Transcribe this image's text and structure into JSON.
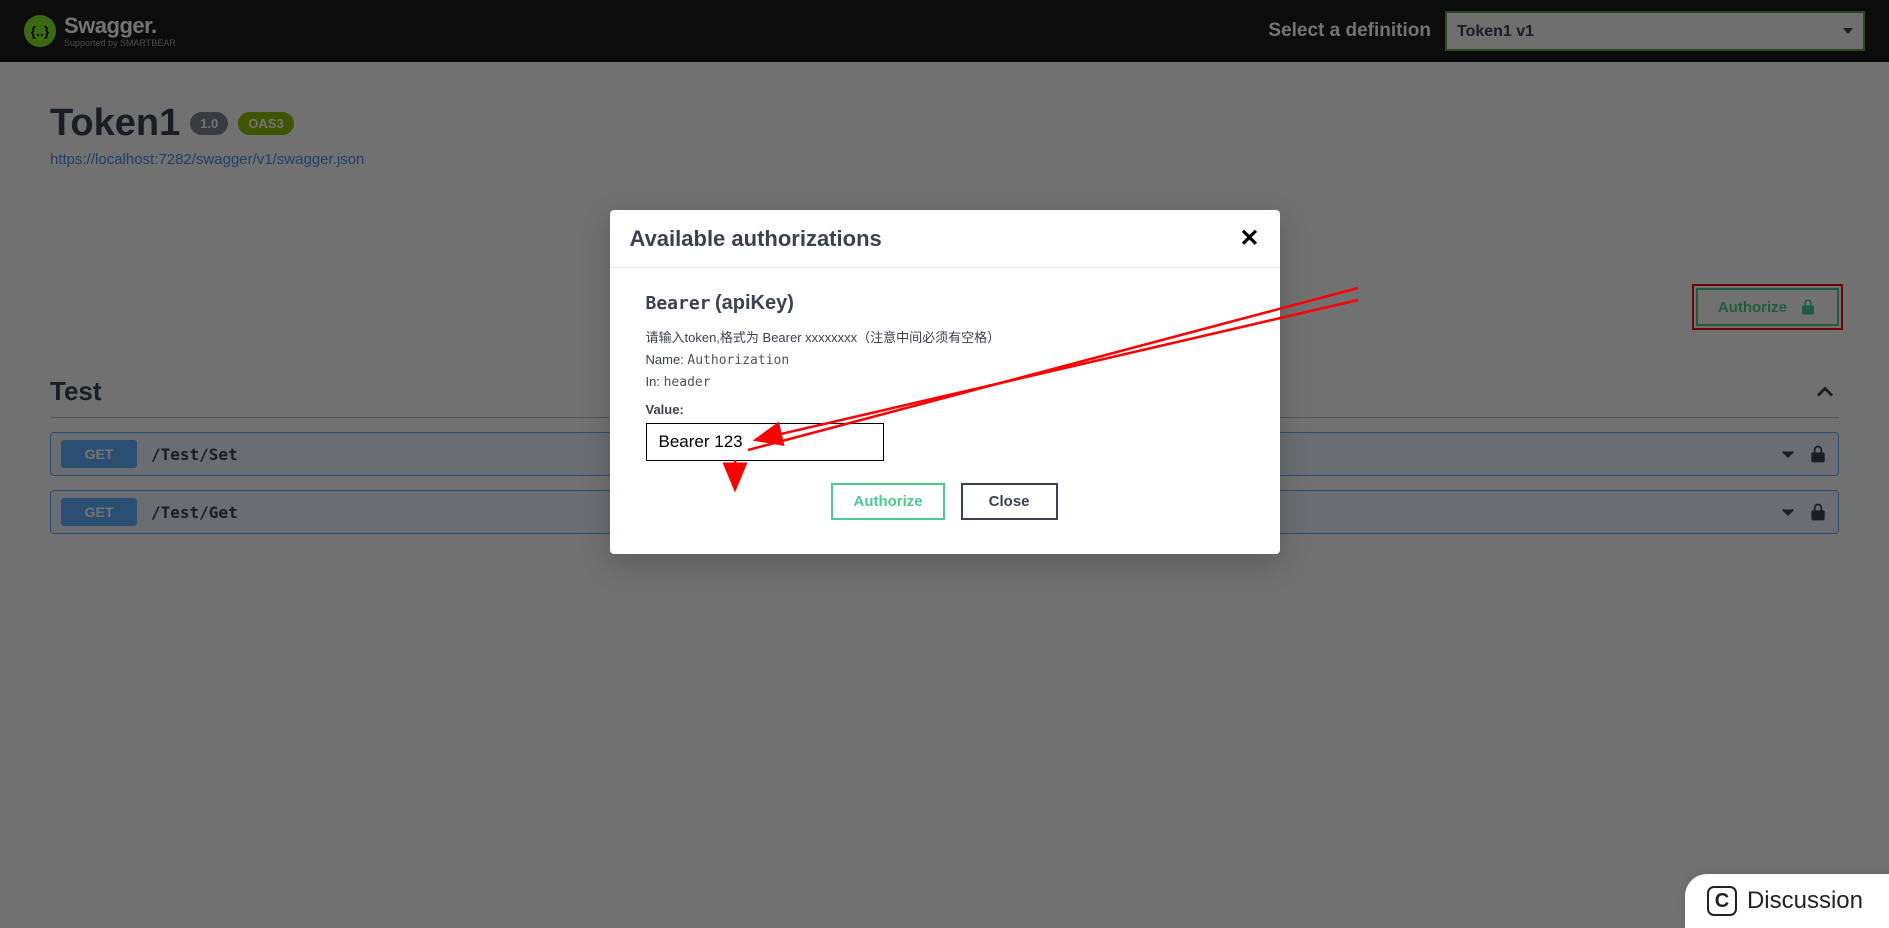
{
  "topbar": {
    "brand_main": "Swagger.",
    "brand_sub": "Supported by SMARTBEAR",
    "logo_glyph": "{..}",
    "select_label": "Select a definition",
    "selected_definition": "Token1 v1"
  },
  "info": {
    "title": "Token1",
    "version": "1.0",
    "oas_badge": "OAS3",
    "swagger_url": "https://localhost:7282/swagger/v1/swagger.json"
  },
  "authorize_main_button": "Authorize",
  "tag": {
    "name": "Test",
    "operations": [
      {
        "method": "GET",
        "path": "/Test/Set"
      },
      {
        "method": "GET",
        "path": "/Test/Get"
      }
    ]
  },
  "modal": {
    "title": "Available authorizations",
    "scheme_name": "Bearer",
    "scheme_type": "(apiKey)",
    "description": "请输入token,格式为 Bearer xxxxxxxx（注意中间必须有空格）",
    "name_key": "Name:",
    "name_val": "Authorization",
    "in_key": "In:",
    "in_val": "header",
    "value_label": "Value:",
    "value_input": "Bearer 123",
    "authorize_btn": "Authorize",
    "close_btn": "Close"
  },
  "discussion_label": "Discussion"
}
